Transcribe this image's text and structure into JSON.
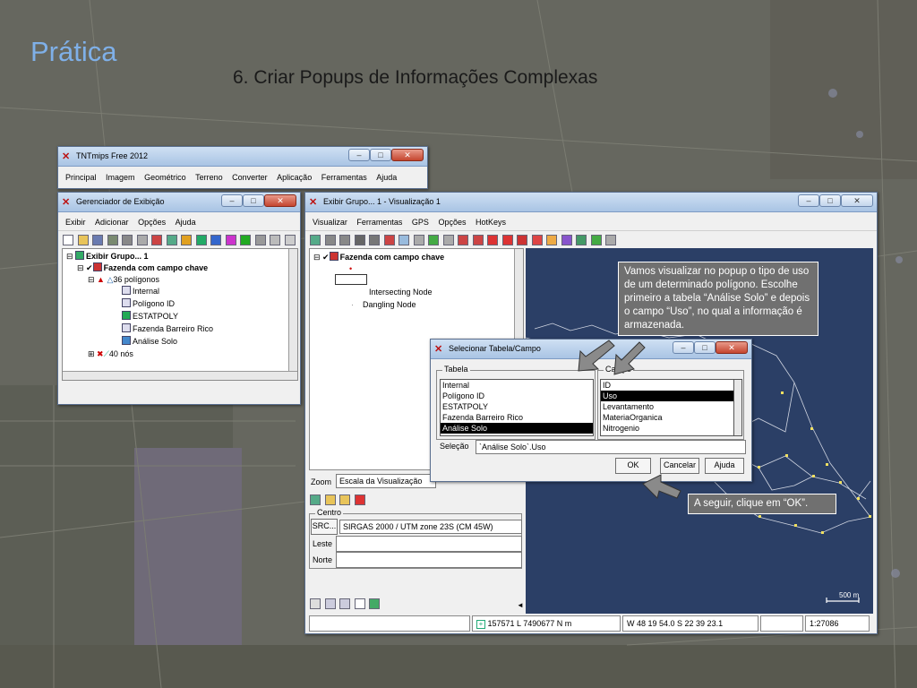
{
  "slide": {
    "title": "Prática",
    "subtitle": "6. Criar Popups de Informações Complexas"
  },
  "colors": {
    "title": "#7fb0e8",
    "map_background": "#2b3f66",
    "callout": "#707070"
  },
  "tntmips_window": {
    "title_prefix": "TNT",
    "title": "mips Free 2012",
    "menu": [
      "Principal",
      "Imagem",
      "Geométrico",
      "Terreno",
      "Converter",
      "Aplicação",
      "Ferramentas",
      "Ajuda"
    ]
  },
  "display_manager": {
    "title": "Gerenciador de Exibição",
    "menu": [
      "Exibir",
      "Adicionar",
      "Opções",
      "Ajuda"
    ],
    "tree": [
      {
        "label": "Exibir Grupo... 1"
      },
      {
        "label": "Fazenda com campo chave"
      },
      {
        "label": "36 polígonos"
      },
      {
        "label": "Internal"
      },
      {
        "label": "Polígono ID"
      },
      {
        "label": "ESTATPOLY"
      },
      {
        "label": "Fazenda Barreiro Rico"
      },
      {
        "label": "Análise Solo"
      },
      {
        "label": "40 nós"
      }
    ]
  },
  "view_window": {
    "title": "Exibir Grupo... 1 - Visualização 1",
    "menu": [
      "Visualizar",
      "Ferramentas",
      "GPS",
      "Opções",
      "HotKeys"
    ],
    "legend": {
      "layer": "Fazenda com campo chave",
      "items": [
        "Intersecting Node",
        "Dangling Node"
      ]
    },
    "zoom_label": "Zoom",
    "zoom_value": "Escala da Visualização",
    "centro_label": "Centro",
    "src_label": "SRC...",
    "src_value": "SIRGAS 2000 / UTM zone 23S (CM 45W)",
    "leste_label": "Leste",
    "norte_label": "Norte",
    "scale_bar": "500 m",
    "status": {
      "coords": "157571 L  7490677 N m",
      "geo": "W 48 19 54.0  S 22 39 23.1",
      "scale": "1:27086"
    }
  },
  "dialog": {
    "title": "Selecionar Tabela/Campo",
    "tabela_label": "Tabela",
    "campo_label": "Campo",
    "tabelas": [
      "Internal",
      "Polígono ID",
      "ESTATPOLY",
      "Fazenda Barreiro Rico",
      "Análise Solo"
    ],
    "tabela_selected": "Análise Solo",
    "campos": [
      "ID",
      "Uso",
      "Levantamento",
      "MateriaOrganica",
      "Nitrogenio"
    ],
    "campo_selected": "Uso",
    "selecao_label": "Seleção",
    "selecao_value": "`Análise Solo`.Uso",
    "ok": "OK",
    "cancel": "Cancelar",
    "help": "Ajuda"
  },
  "callouts": {
    "info": "Vamos visualizar no popup o tipo de uso de um determinado polígono. Escolhe primeiro a tabela “Análise Solo” e depois o campo “Uso”, no qual a informação é armazenada.",
    "next": "A seguir, clique em “OK”."
  }
}
